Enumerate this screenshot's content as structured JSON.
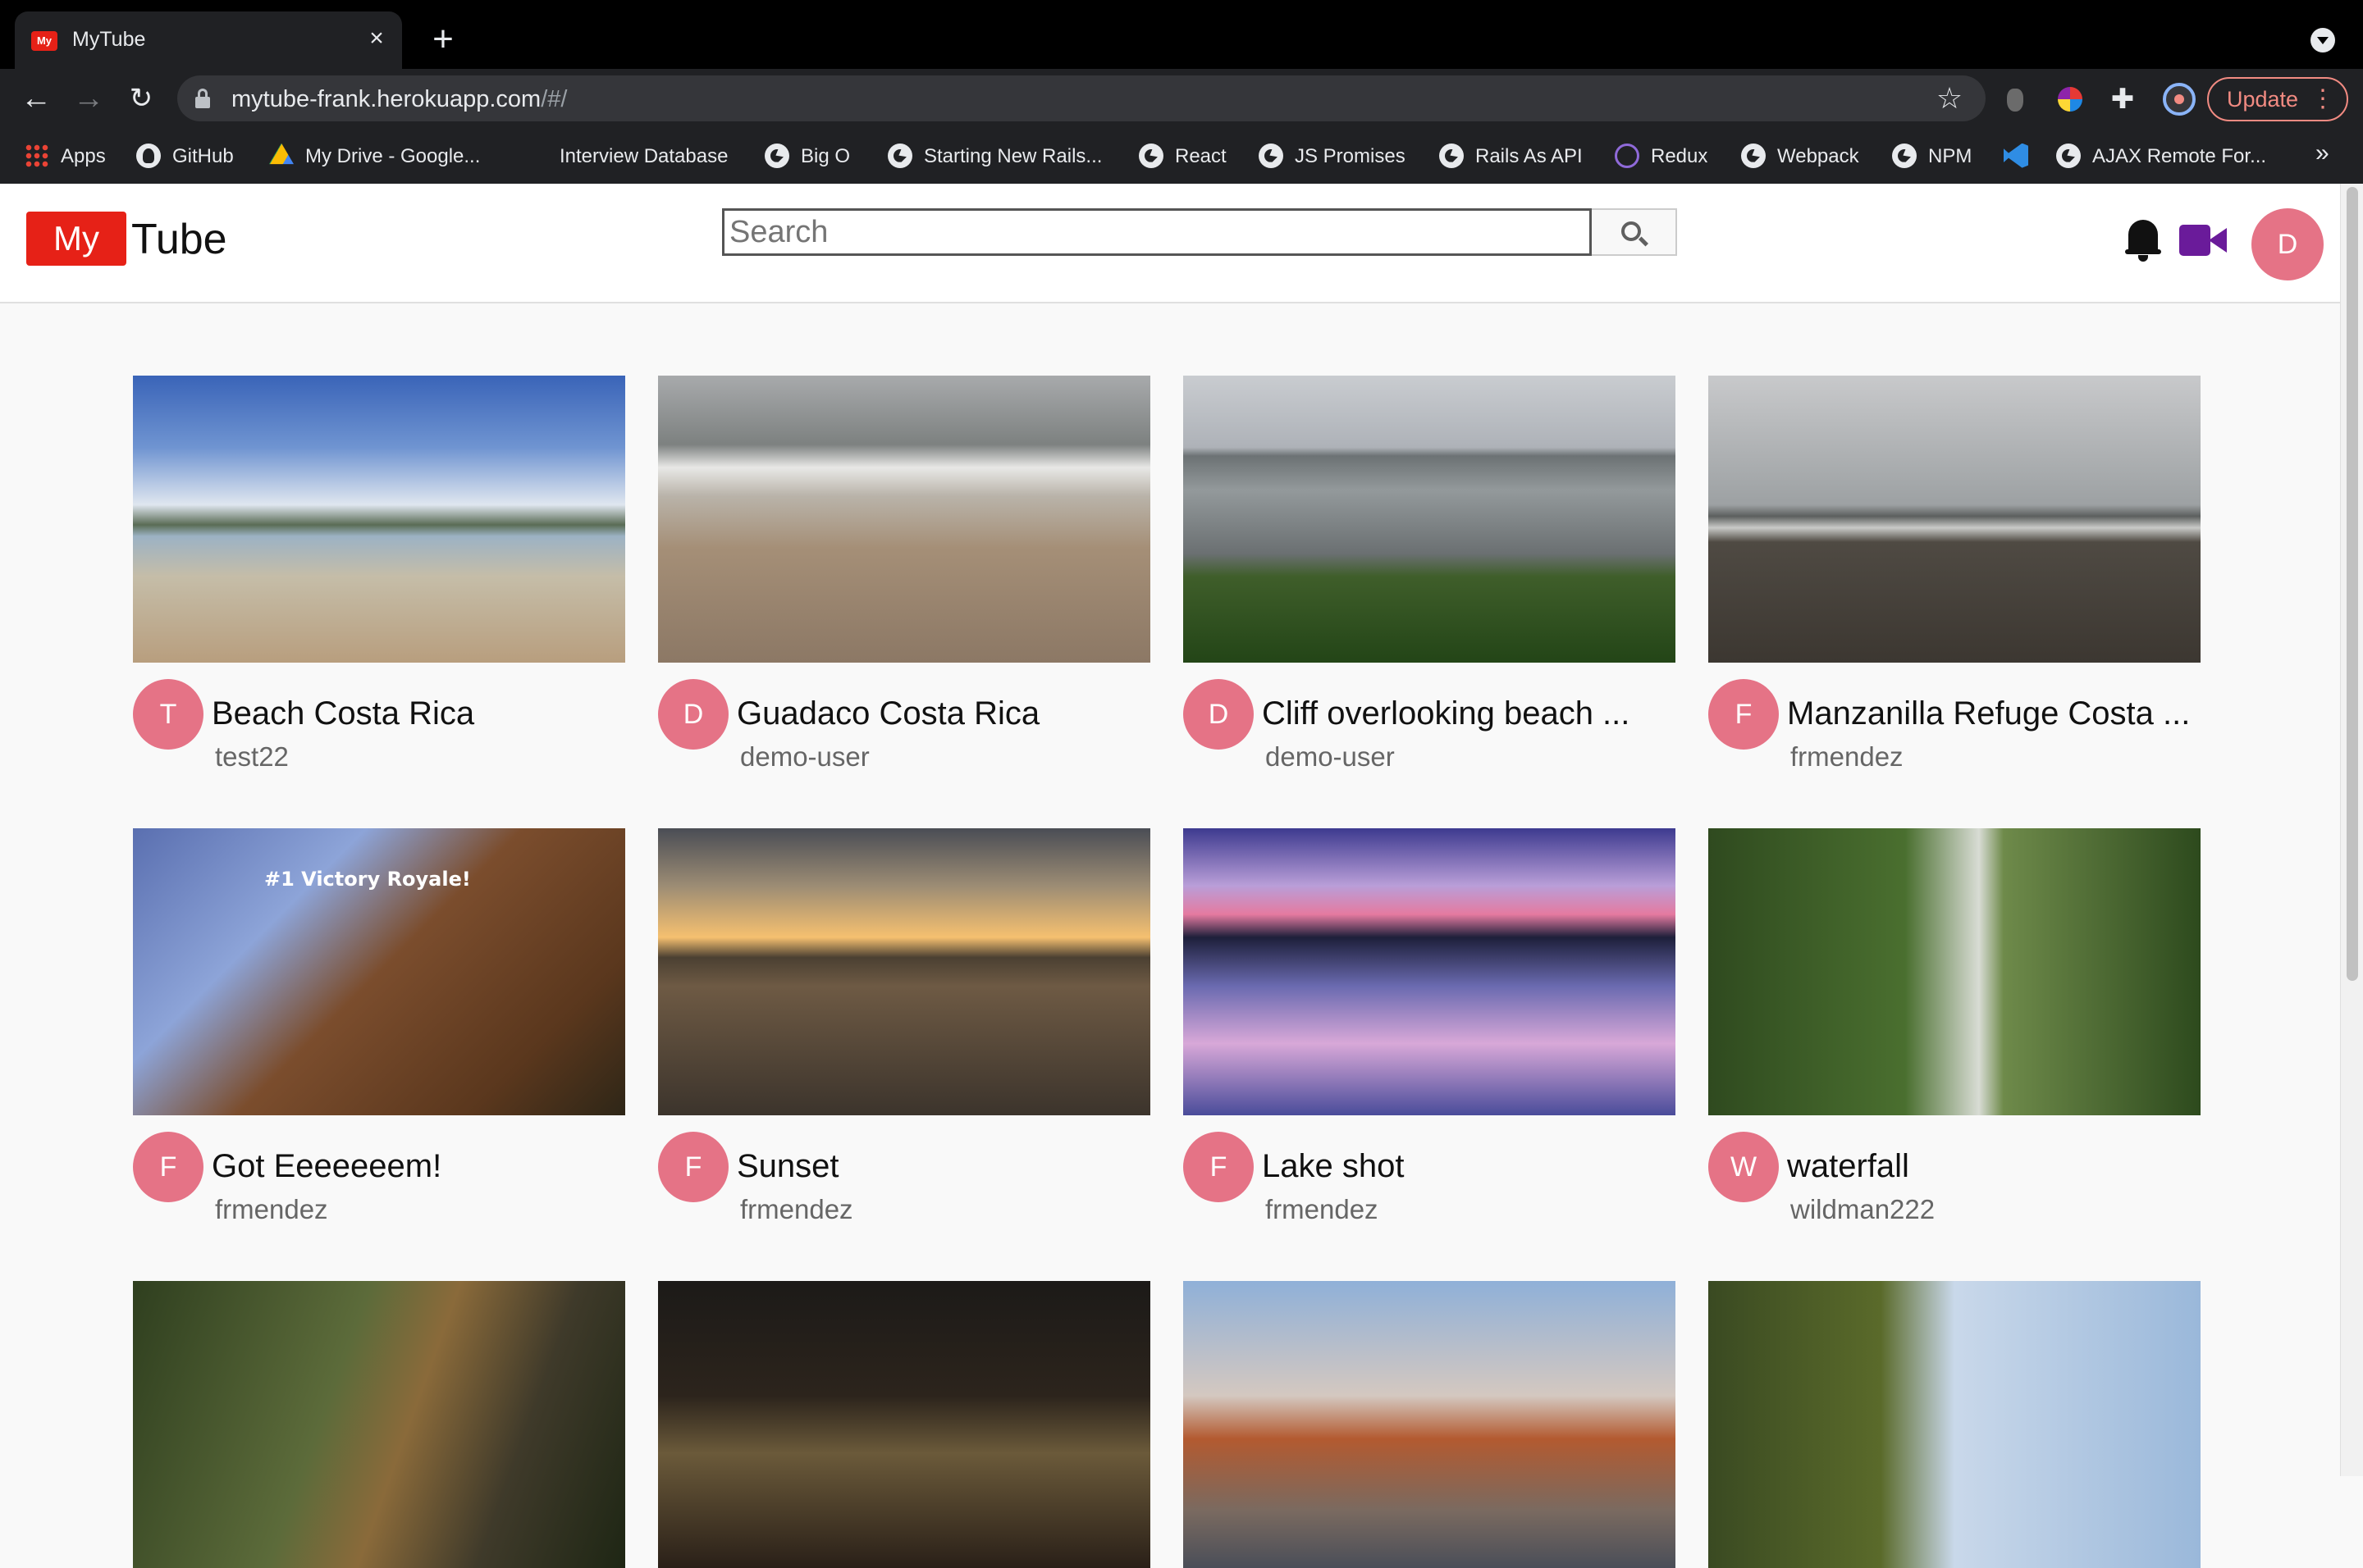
{
  "browser": {
    "tab_title": "MyTube",
    "tab_favicon_text": "My",
    "url_host": "mytube-frank.herokuapp.com",
    "url_rest": "/#/",
    "update_label": "Update",
    "bookmarks": [
      {
        "label": "Apps",
        "icon": "apps-icon"
      },
      {
        "label": "GitHub",
        "icon": "github-icon"
      },
      {
        "label": "My Drive - Google...",
        "icon": "google-drive-icon"
      },
      {
        "label": "Interview Database",
        "icon": ""
      },
      {
        "label": "Big O",
        "icon": "globe-icon"
      },
      {
        "label": "Starting New Rails...",
        "icon": "globe-icon"
      },
      {
        "label": "React",
        "icon": "globe-icon"
      },
      {
        "label": "JS Promises",
        "icon": "globe-icon"
      },
      {
        "label": "Rails As API",
        "icon": "globe-icon"
      },
      {
        "label": "Redux",
        "icon": "redux-icon"
      },
      {
        "label": "Webpack",
        "icon": "globe-icon"
      },
      {
        "label": "NPM",
        "icon": "globe-icon"
      },
      {
        "label": "",
        "icon": "vscode-icon"
      },
      {
        "label": "AJAX Remote For...",
        "icon": "globe-icon"
      }
    ],
    "more_bookmarks": "»"
  },
  "app": {
    "logo_box": "My",
    "logo_text": "Tube",
    "search_placeholder": "Search",
    "user_initial": "D",
    "accent_color": "#e62117",
    "avatar_color": "#e57386"
  },
  "videos": [
    {
      "title": "Beach Costa Rica",
      "author": "test22",
      "initial": "T"
    },
    {
      "title": "Guadaco Costa Rica",
      "author": "demo-user",
      "initial": "D"
    },
    {
      "title": "Cliff overlooking beach ...",
      "author": "demo-user",
      "initial": "D"
    },
    {
      "title": "Manzanilla Refuge Costa ...",
      "author": "frmendez",
      "initial": "F"
    },
    {
      "title": "Got Eeeeeeem!",
      "author": "frmendez",
      "initial": "F"
    },
    {
      "title": "Sunset",
      "author": "frmendez",
      "initial": "F"
    },
    {
      "title": "Lake shot",
      "author": "frmendez",
      "initial": "F"
    },
    {
      "title": "waterfall",
      "author": "wildman222",
      "initial": "W"
    },
    {
      "title": "",
      "author": "",
      "initial": ""
    },
    {
      "title": "",
      "author": "",
      "initial": ""
    },
    {
      "title": "",
      "author": "",
      "initial": ""
    },
    {
      "title": "",
      "author": "",
      "initial": ""
    }
  ],
  "thumb_overlays": {
    "victory_text": "#1 Victory Royale!"
  }
}
